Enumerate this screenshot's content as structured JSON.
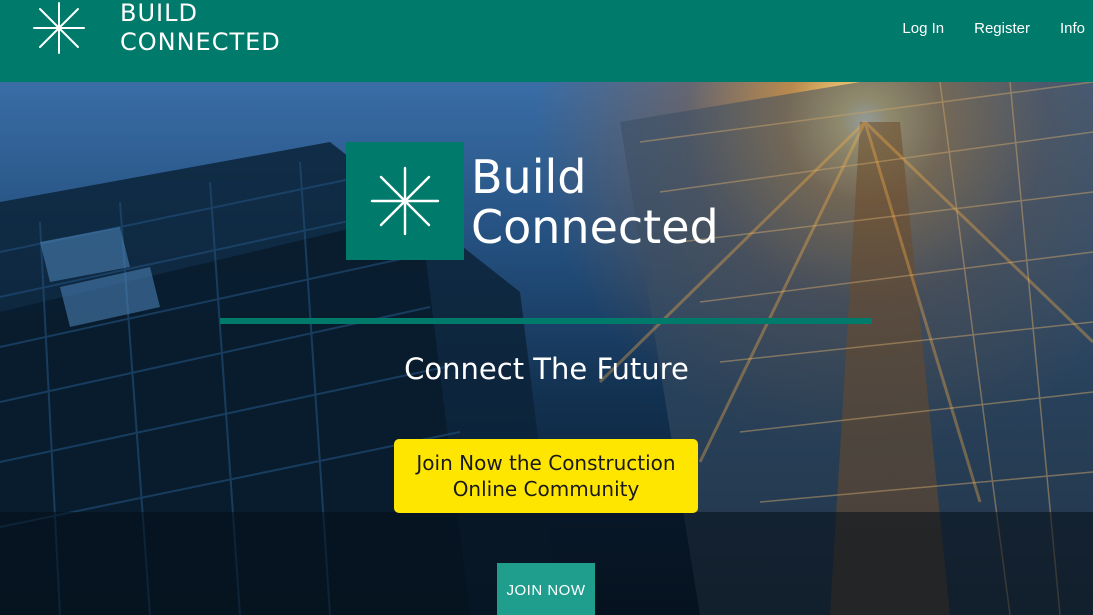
{
  "header": {
    "brand_line1": "BUILD",
    "brand_line2": "CONNECTED",
    "brand_icon": "asterisk-star-icon",
    "nav": {
      "login": "Log In",
      "register": "Register",
      "info": "Info"
    }
  },
  "hero": {
    "logo_icon": "asterisk-star-icon",
    "logo_word_line1": "Build",
    "logo_word_line2": "Connected",
    "tagline": "Connect The Future",
    "cta_line1": "Join Now the Construction",
    "cta_line2": "Online Community",
    "join_button": "JOIN NOW"
  },
  "colors": {
    "brand_green": "#007a6b",
    "cta_yellow": "#ffe600",
    "join_button": "#1f9e8e"
  }
}
